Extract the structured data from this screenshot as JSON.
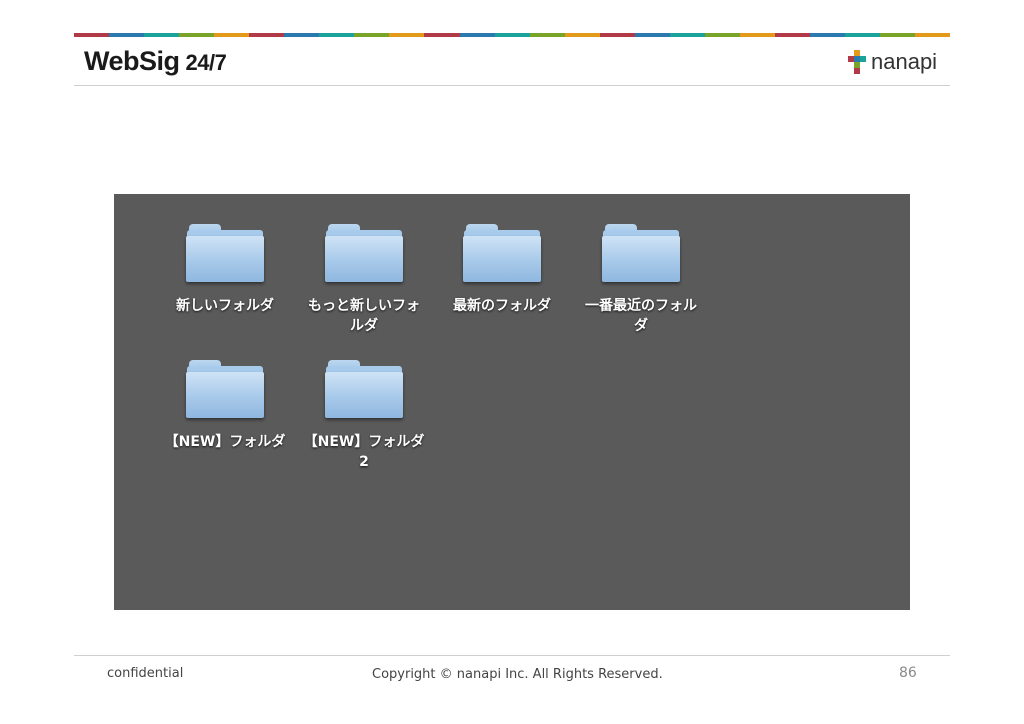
{
  "header": {
    "logo_main": "WebSig",
    "logo_sub": "24/7",
    "brand": "nanapi",
    "stripe_colors": [
      "#b23a48",
      "#2a7ab0",
      "#1aa39a",
      "#7aa32a",
      "#e39a1a",
      "#b23a48",
      "#2a7ab0",
      "#1aa39a",
      "#7aa32a",
      "#e39a1a",
      "#b23a48",
      "#2a7ab0",
      "#1aa39a",
      "#7aa32a",
      "#e39a1a",
      "#b23a48",
      "#2a7ab0",
      "#1aa39a",
      "#7aa32a",
      "#e39a1a",
      "#b23a48",
      "#2a7ab0",
      "#1aa39a",
      "#7aa32a",
      "#e39a1a"
    ]
  },
  "finder": {
    "background": "#5a5a5a",
    "folders": [
      {
        "label": "新しいフォルダ"
      },
      {
        "label": "もっと新しいフォルダ"
      },
      {
        "label": "最新のフォルダ"
      },
      {
        "label": "一番最近のフォルダ"
      },
      {
        "label": "【NEW】フォルダ"
      },
      {
        "label": "【NEW】フォルダ2"
      }
    ]
  },
  "footer": {
    "left": "confidential",
    "center": "Copyright © nanapi Inc. All Rights Reserved.",
    "page": "86"
  }
}
